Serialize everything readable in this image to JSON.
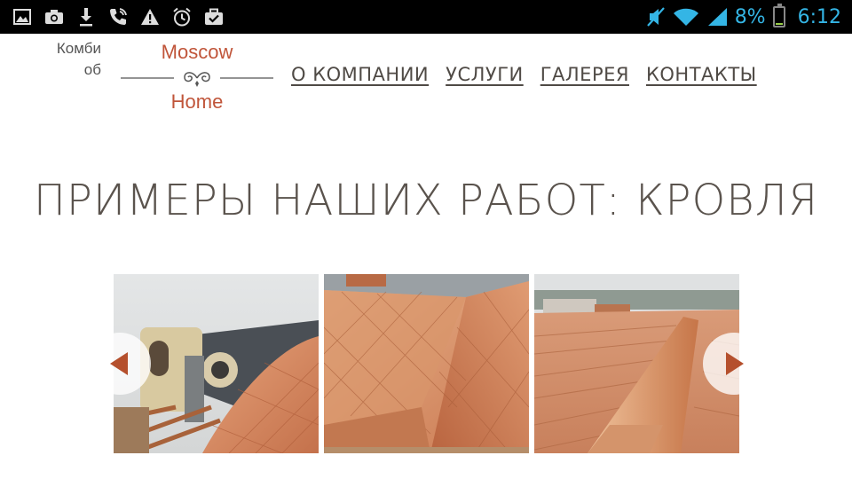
{
  "status_bar": {
    "left_icons": [
      "gallery-icon",
      "camera-icon",
      "download-icon",
      "call-icon",
      "warning-icon",
      "alarm-icon",
      "briefcase-icon"
    ],
    "battery_percent": "8%",
    "time": "6:12",
    "battery_level": 0.08,
    "accent_color": "#34b5e5"
  },
  "header": {
    "tagline_line1": "Комби",
    "tagline_line2": "об",
    "logo_line1": "Moscow",
    "logo_line2": "Home",
    "brand_color": "#c0553a"
  },
  "nav": {
    "items": [
      "О КОМПАНИИ",
      "УСЛУГИ",
      "ГАЛЕРЕЯ",
      "КОНТАКТЫ"
    ]
  },
  "page": {
    "title": "ПРИМЕРЫ НАШИХ РАБОТ: КРОВЛЯ"
  },
  "gallery": {
    "photos": [
      "roof-photo-1",
      "roof-photo-2",
      "roof-photo-3"
    ],
    "arrow_color": "#b5502d"
  }
}
